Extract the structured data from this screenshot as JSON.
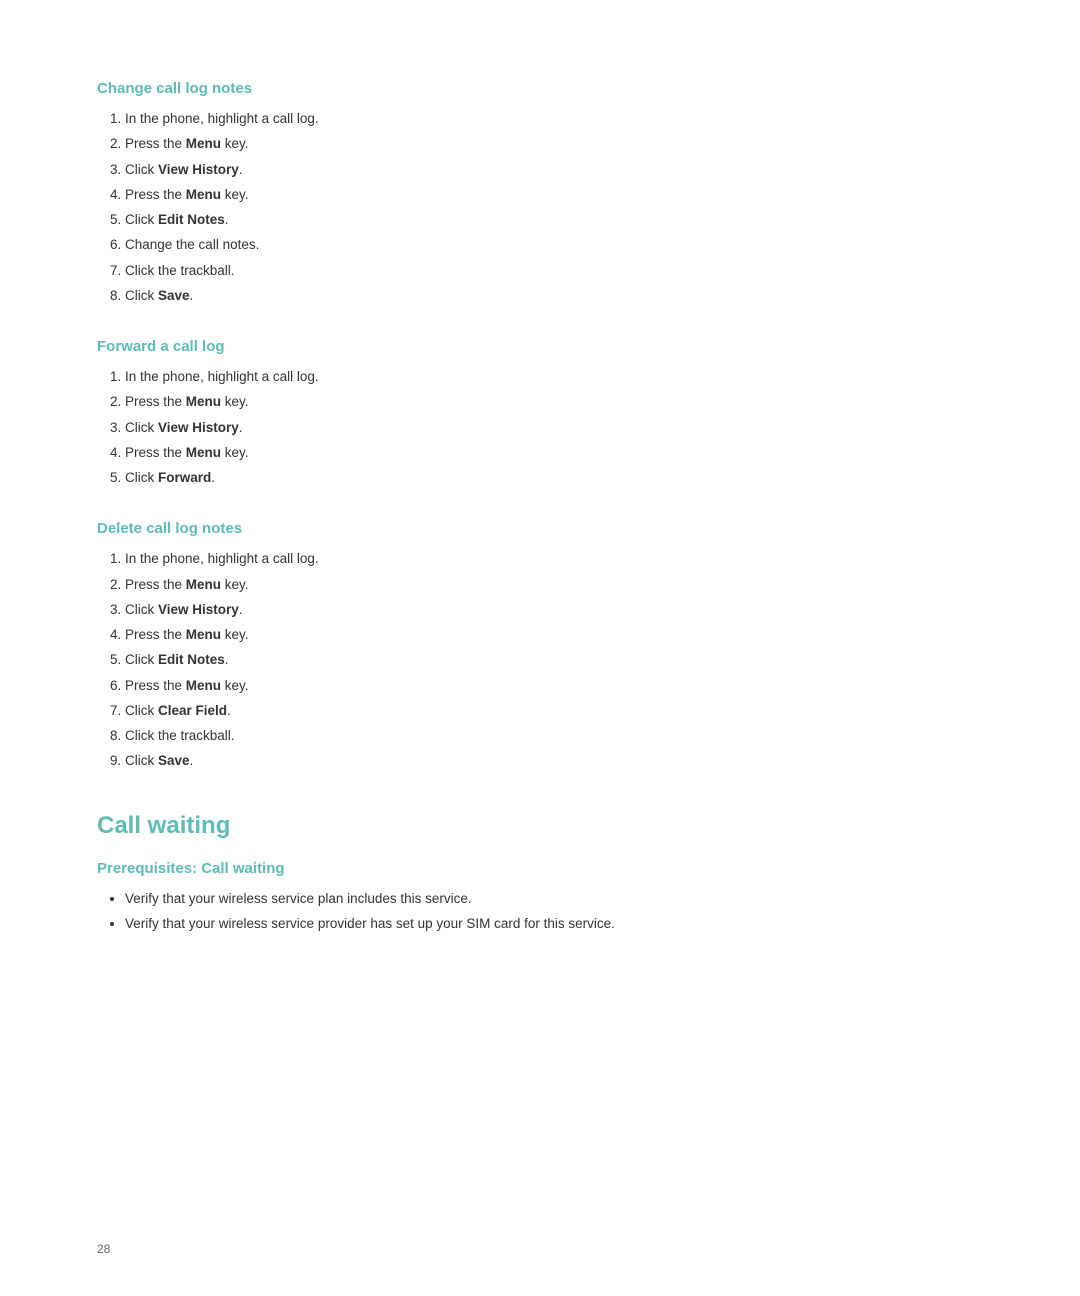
{
  "page": {
    "number": "28"
  },
  "sections": {
    "change_call_log_notes": {
      "title": "Change call log notes",
      "steps": [
        {
          "text": "In the phone, highlight a call log."
        },
        {
          "text": "Press the ",
          "bold": "Menu",
          "suffix": " key."
        },
        {
          "text": "Click ",
          "bold": "View History",
          "suffix": "."
        },
        {
          "text": "Press the ",
          "bold": "Menu",
          "suffix": " key."
        },
        {
          "text": "Click ",
          "bold": "Edit Notes",
          "suffix": "."
        },
        {
          "text": "Change the call notes."
        },
        {
          "text": "Click the trackball."
        },
        {
          "text": "Click ",
          "bold": "Save",
          "suffix": "."
        }
      ]
    },
    "forward_a_call_log": {
      "title": "Forward a call log",
      "steps": [
        {
          "text": "In the phone, highlight a call log."
        },
        {
          "text": "Press the ",
          "bold": "Menu",
          "suffix": " key."
        },
        {
          "text": "Click ",
          "bold": "View History",
          "suffix": "."
        },
        {
          "text": "Press the ",
          "bold": "Menu",
          "suffix": " key."
        },
        {
          "text": "Click ",
          "bold": "Forward",
          "suffix": "."
        }
      ]
    },
    "delete_call_log_notes": {
      "title": "Delete call log notes",
      "steps": [
        {
          "text": "In the phone, highlight a call log."
        },
        {
          "text": "Press the ",
          "bold": "Menu",
          "suffix": " key."
        },
        {
          "text": "Click ",
          "bold": "View History",
          "suffix": "."
        },
        {
          "text": "Press the ",
          "bold": "Menu",
          "suffix": " key."
        },
        {
          "text": "Click ",
          "bold": "Edit Notes",
          "suffix": "."
        },
        {
          "text": "Press the ",
          "bold": "Menu",
          "suffix": " key."
        },
        {
          "text": "Click ",
          "bold": "Clear Field",
          "suffix": "."
        },
        {
          "text": "Click the trackball."
        },
        {
          "text": "Click ",
          "bold": "Save",
          "suffix": "."
        }
      ]
    },
    "call_waiting": {
      "title": "Call waiting",
      "prerequisites": {
        "title": "Prerequisites: Call waiting",
        "bullets": [
          "Verify that your wireless service plan includes this service.",
          "Verify that your wireless service provider has set up your SIM card for this service."
        ]
      }
    }
  }
}
